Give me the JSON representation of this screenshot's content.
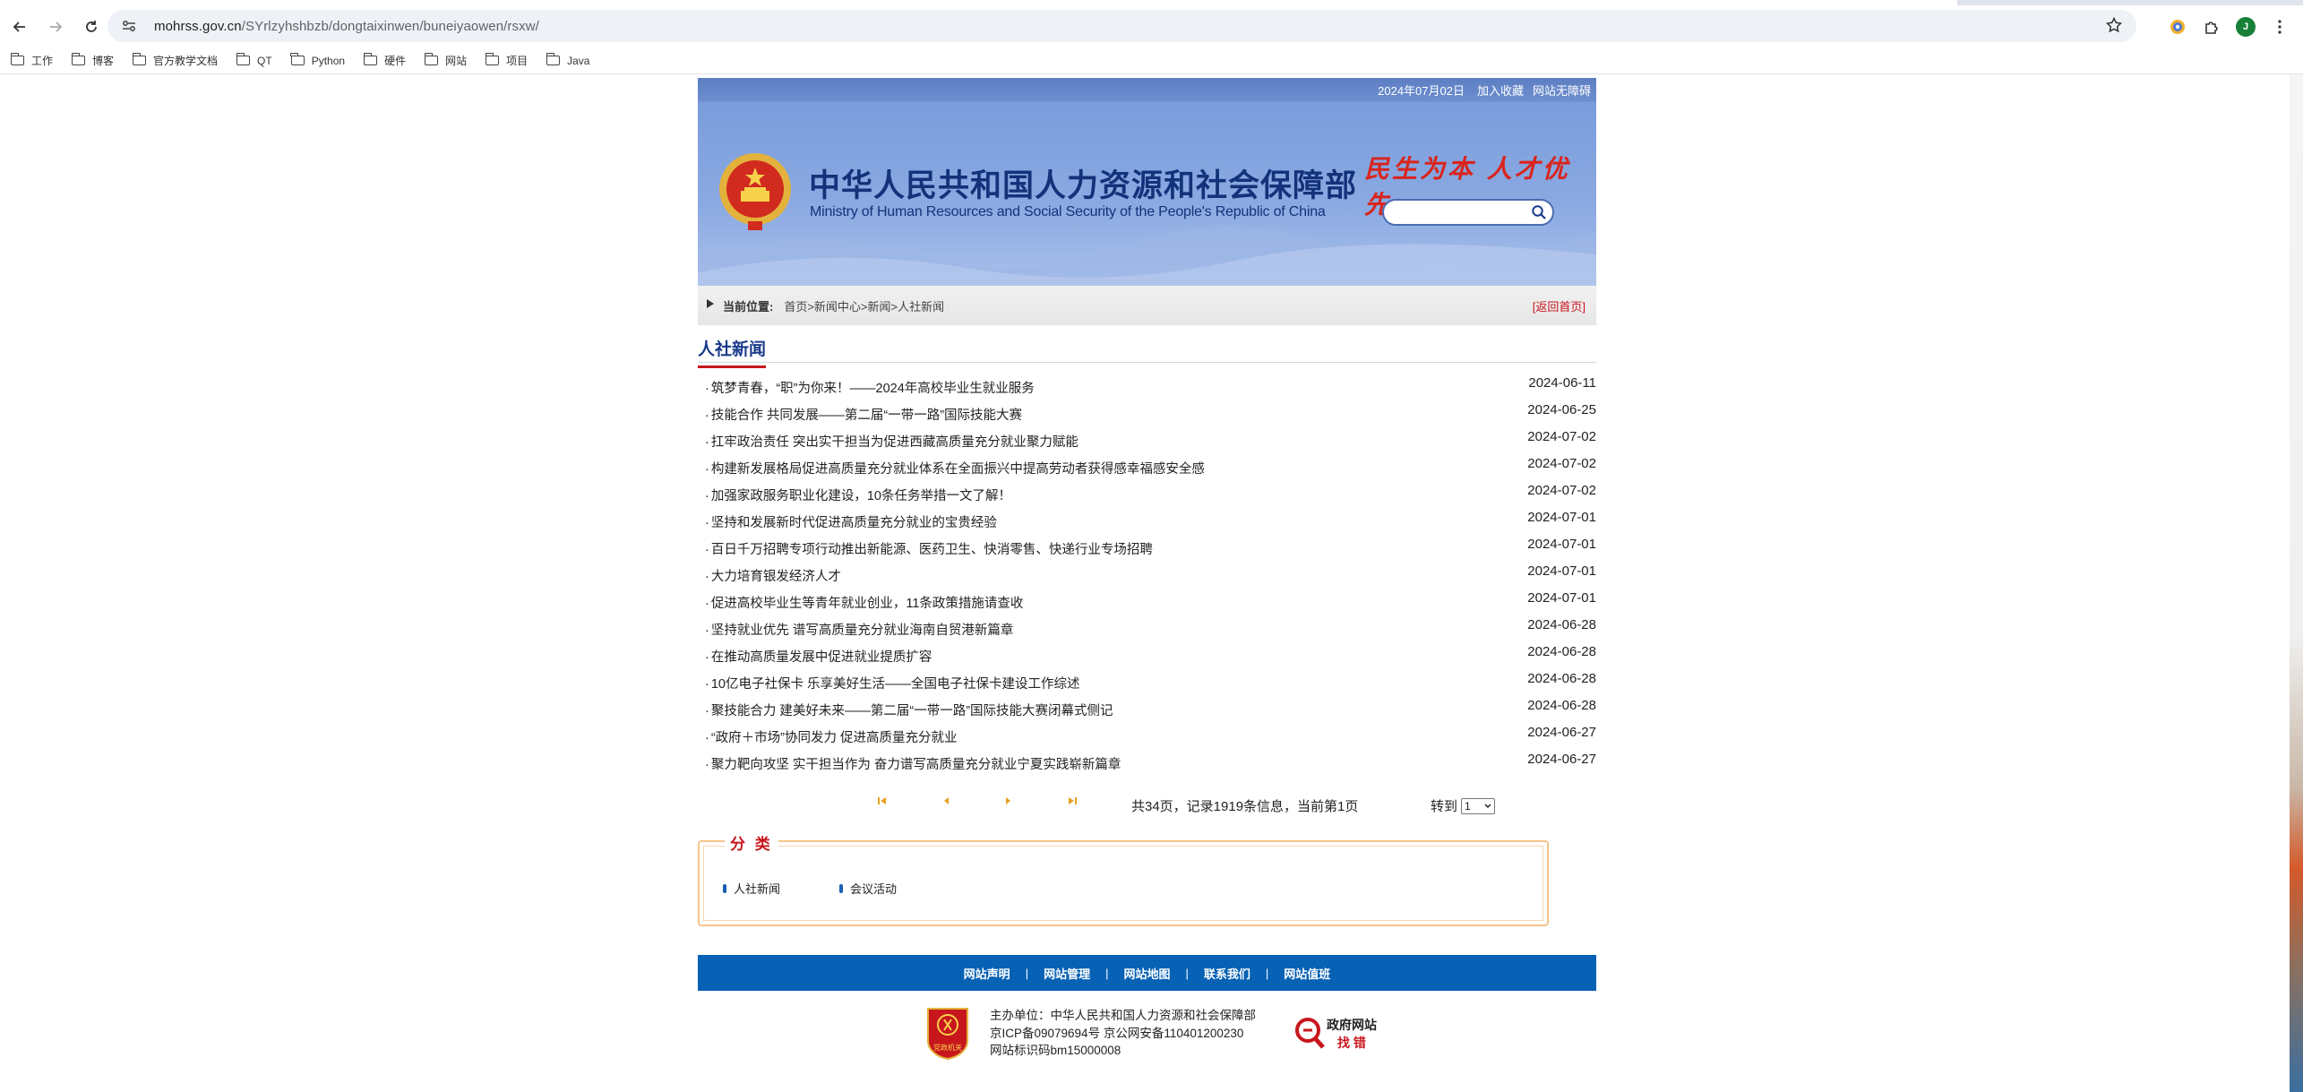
{
  "browser": {
    "url_host": "mohrss.gov.cn",
    "url_path": "/SYrlzyhshbzb/dongtaixinwen/buneiyaowen/rsxw/",
    "profile_initial": "J",
    "bookmarks": [
      "工作",
      "博客",
      "官方教学文档",
      "QT",
      "Python",
      "硬件",
      "网站",
      "项目",
      "Java"
    ]
  },
  "header": {
    "date": "2024年07月02日",
    "add_favorite": "加入收藏",
    "accessibility": "网站无障碍",
    "title_cn": "中华人民共和国人力资源和社会保障部",
    "title_en": "Ministry of Human Resources and Social Security of the People's Republic of China",
    "slogan": "民生为本  人才优先",
    "search_placeholder": ""
  },
  "breadcrumb": {
    "label": "当前位置:",
    "path": "首页>新闻中心>新闻>人社新闻",
    "home_link": "[返回首页]"
  },
  "section_title": "人社新闻",
  "news": [
    {
      "title": "筑梦青春，“职”为你来！——2024年高校毕业生就业服务",
      "date": "2024-06-11"
    },
    {
      "title": "技能合作 共同发展——第二届“一带一路”国际技能大赛",
      "date": "2024-06-25"
    },
    {
      "title": "扛牢政治责任 突出实干担当为促进西藏高质量充分就业聚力赋能",
      "date": "2024-07-02"
    },
    {
      "title": "构建新发展格局促进高质量充分就业体系在全面振兴中提高劳动者获得感幸福感安全感",
      "date": "2024-07-02"
    },
    {
      "title": "加强家政服务职业化建设，10条任务举措一文了解！",
      "date": "2024-07-02"
    },
    {
      "title": "坚持和发展新时代促进高质量充分就业的宝贵经验",
      "date": "2024-07-01"
    },
    {
      "title": "百日千万招聘专项行动推出新能源、医药卫生、快消零售、快递行业专场招聘",
      "date": "2024-07-01"
    },
    {
      "title": "大力培育银发经济人才",
      "date": "2024-07-01"
    },
    {
      "title": "促进高校毕业生等青年就业创业，11条政策措施请查收",
      "date": "2024-07-01"
    },
    {
      "title": "坚持就业优先 谱写高质量充分就业海南自贸港新篇章",
      "date": "2024-06-28"
    },
    {
      "title": "在推动高质量发展中促进就业提质扩容",
      "date": "2024-06-28"
    },
    {
      "title": "10亿电子社保卡 乐享美好生活——全国电子社保卡建设工作综述",
      "date": "2024-06-28"
    },
    {
      "title": "聚技能合力 建美好未来——第二届“一带一路”国际技能大赛闭幕式侧记",
      "date": "2024-06-28"
    },
    {
      "title": "“政府＋市场”协同发力 促进高质量充分就业",
      "date": "2024-06-27"
    },
    {
      "title": "聚力靶向攻坚 实干担当作为 奋力谱写高质量充分就业宁夏实践崭新篇章",
      "date": "2024-06-27"
    }
  ],
  "pager": {
    "info": "共34页，记录1919条信息，当前第1页",
    "goto_label": "转到",
    "selected_page": "1"
  },
  "category": {
    "legend": "分 类",
    "items": [
      "人社新闻",
      "会议活动"
    ]
  },
  "footer": {
    "links": [
      "网站声明",
      "网站管理",
      "网站地图",
      "联系我们",
      "网站值班"
    ],
    "sponsor": "主办单位：中华人民共和国人力资源和社会保障部",
    "icp": "京ICP备09079694号 京公网安备110401200230",
    "site_id": "网站标识码bm15000008",
    "badge_text": "党政机关",
    "gov_site_line1": "政府网站",
    "gov_site_line2": "找 错"
  },
  "colors": {
    "accent_red": "#c8161d",
    "title_blue": "#13327a",
    "footer_blue": "#0761b5",
    "category_border": "#f5c48a"
  }
}
